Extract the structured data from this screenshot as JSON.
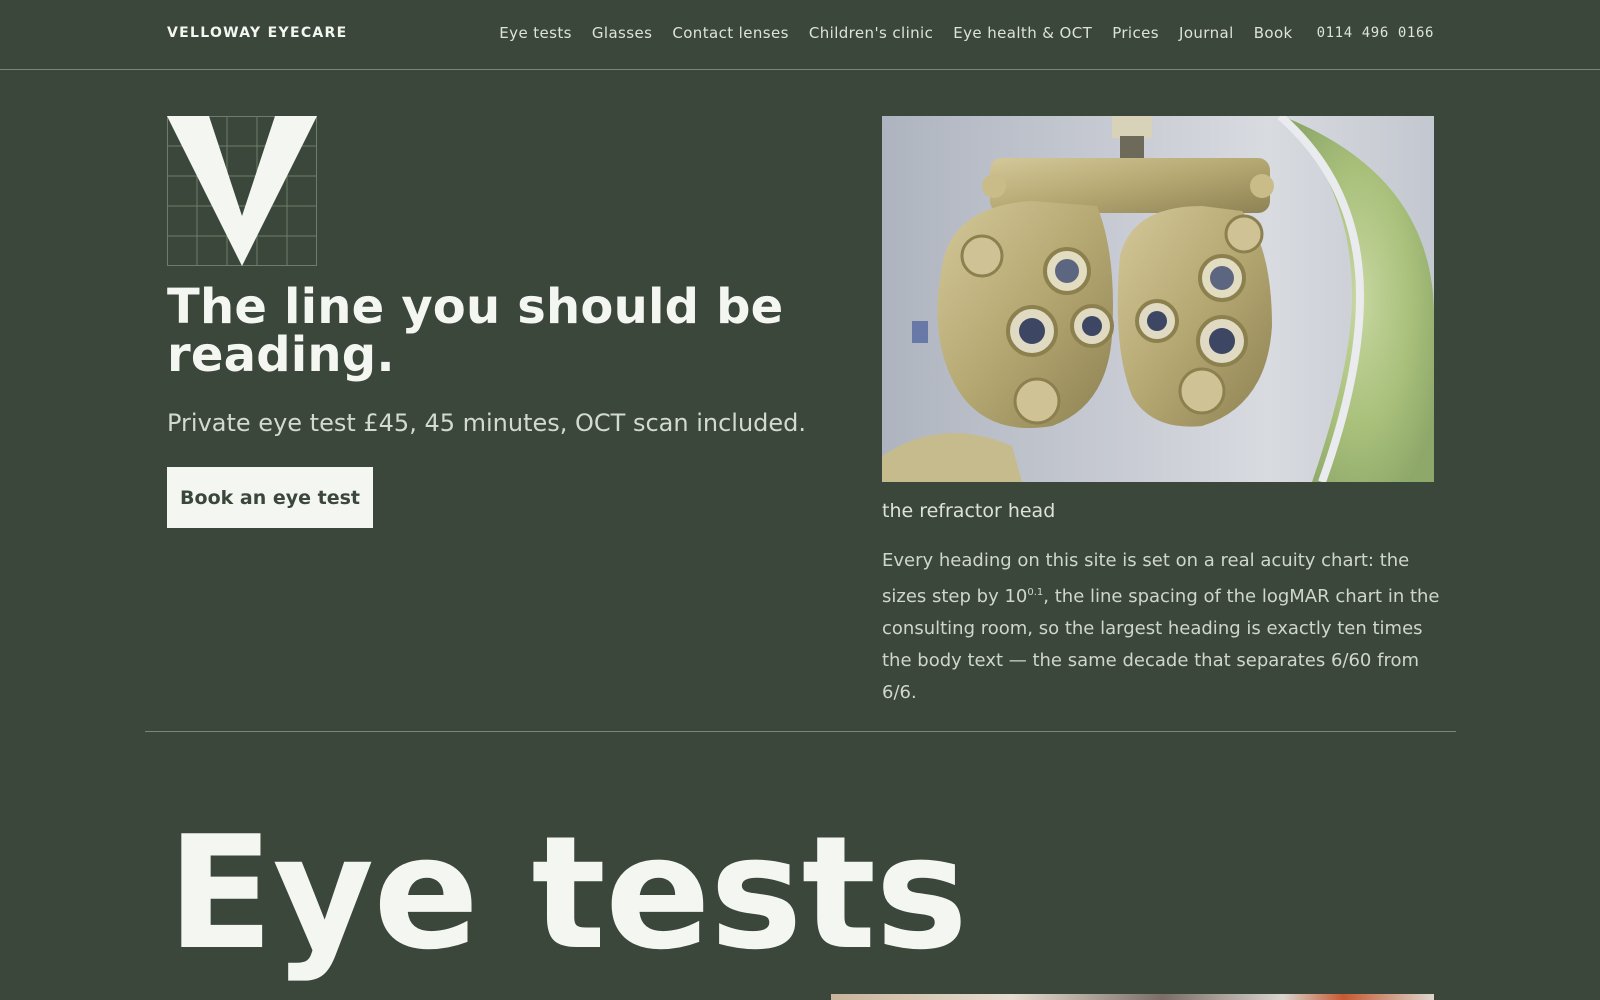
{
  "header": {
    "brand": "VELLOWAY EYECARE",
    "nav": [
      {
        "label": "Eye tests"
      },
      {
        "label": "Glasses"
      },
      {
        "label": "Contact lenses"
      },
      {
        "label": "Children's clinic"
      },
      {
        "label": "Eye health & OCT"
      },
      {
        "label": "Prices"
      },
      {
        "label": "Journal"
      },
      {
        "label": "Book"
      }
    ],
    "phone": "0114 496 0166"
  },
  "hero": {
    "logo_icon": "v-logo-grid-icon",
    "title": "The line you should be reading.",
    "subtitle": "Private eye test £45, 45 minutes, OCT scan included.",
    "cta_label": "Book an eye test",
    "image_caption": "the refractor head",
    "body_before_sup": "Every heading on this site is set on a real acuity chart: the sizes step by 10",
    "body_sup": "0.1",
    "body_after_sup": ", the line spacing of the logMAR chart in the consulting room, so the largest heading is exactly ten times the body text — the same decade that separates 6/60 from 6/6."
  },
  "section": {
    "heading": "Eye tests"
  },
  "colors": {
    "background": "#3b473a",
    "text": "#f4f6f2",
    "muted_text": "#cfd6cb",
    "button_bg": "#f4f6f2"
  }
}
